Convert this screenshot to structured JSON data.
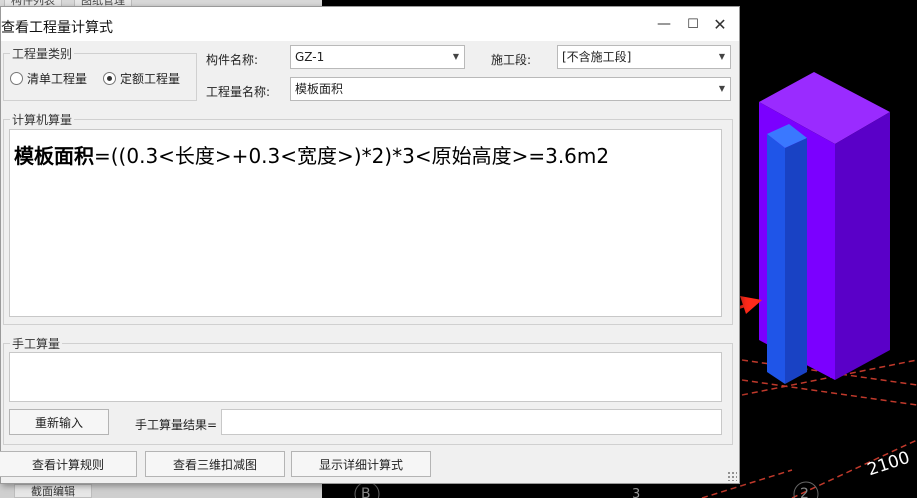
{
  "background_app": {
    "top_tabs": [
      "构件列表",
      "图纸管理"
    ],
    "bottom_tab": "截面编辑"
  },
  "dialog": {
    "title": "查看工程量计算式",
    "quantity_type": {
      "legend": "工程量类别",
      "options": [
        {
          "label": "清单工程量",
          "selected": false
        },
        {
          "label": "定额工程量",
          "selected": true
        }
      ]
    },
    "component_name": {
      "label": "构件名称:",
      "value": "GZ-1"
    },
    "construction_stage": {
      "label": "施工段:",
      "value": "[不含施工段]"
    },
    "quantity_name": {
      "label": "工程量名称:",
      "value": "模板面积"
    },
    "computer_calc": {
      "legend": "计算机算量",
      "formula_name": "模板面积",
      "formula_expr": "=((0.3<长度>+0.3<宽度>)*2)*3<原始高度>=3.6m2"
    },
    "manual_calc": {
      "legend": "手工算量",
      "reenter_button": "重新输入",
      "result_label": "手工算量结果=",
      "result_value": ""
    },
    "buttons": {
      "view_rules": "查看计算规则",
      "view_3d": "查看三维扣减图",
      "show_detail": "显示详细计算式"
    }
  },
  "viewport": {
    "dimension_label": "2100",
    "axis_labels": [
      "B",
      "3",
      "2"
    ],
    "colors": {
      "column": "#7b00ff",
      "column_dark": "#5a00c8",
      "column_top": "#9a2bff",
      "formwork": "#1f55e8",
      "arrow": "#ff2a1a",
      "grid": "#c0392b"
    }
  }
}
